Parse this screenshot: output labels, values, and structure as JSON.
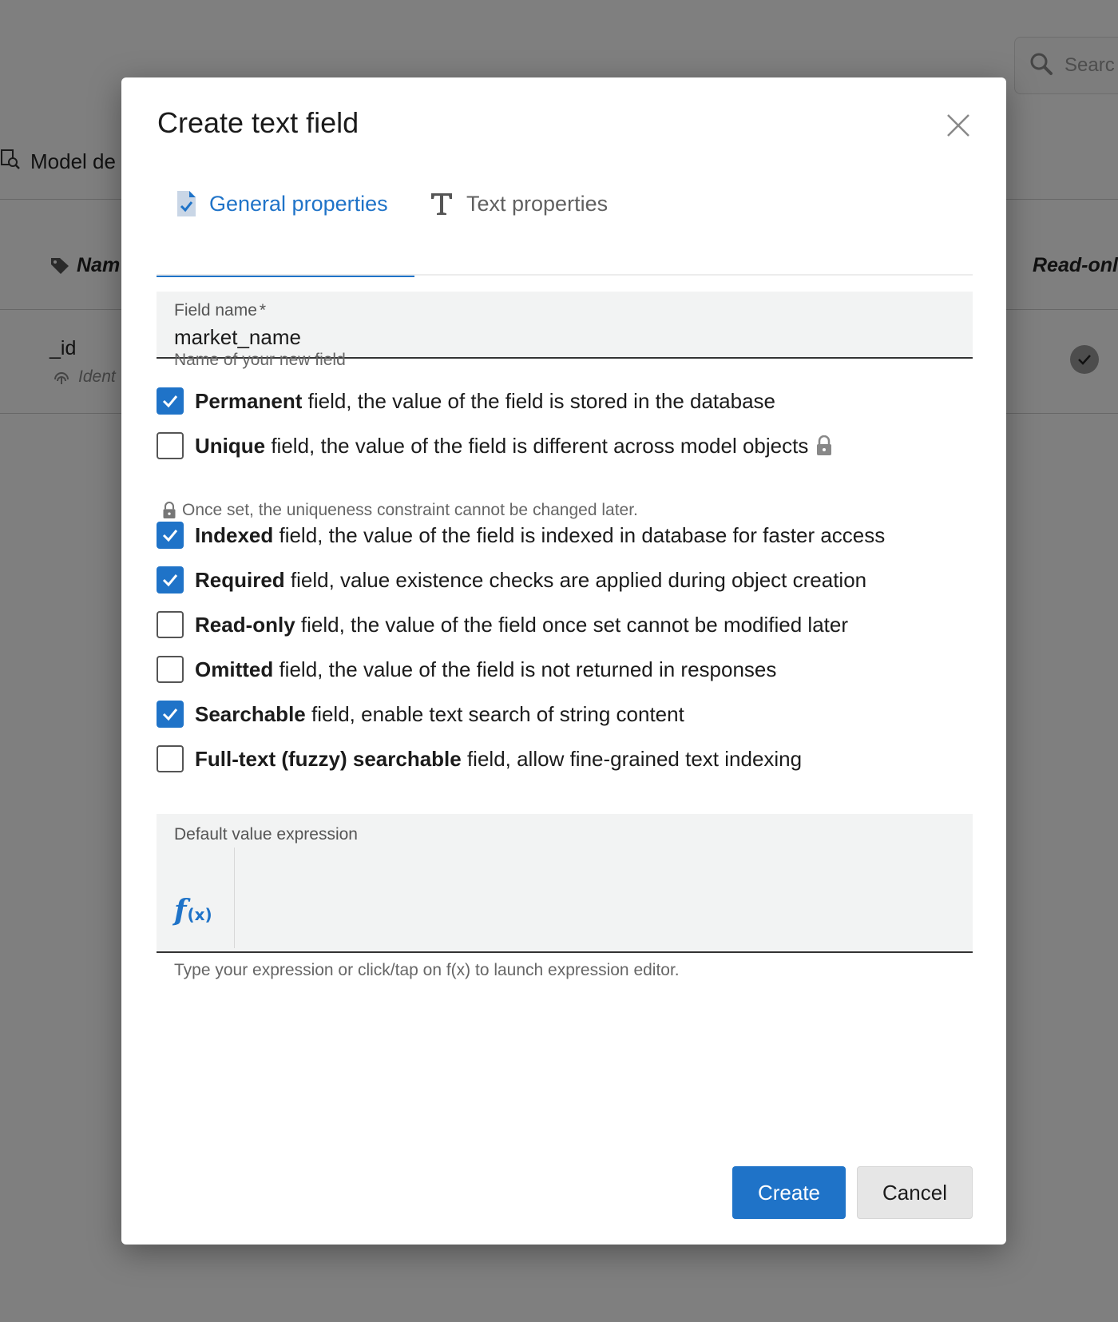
{
  "background": {
    "search_placeholder": "Searc",
    "model_label": "Model de",
    "column_name": "Nam",
    "column_readonly": "Read-onl",
    "row_id": "_id",
    "row_sub": "Ident"
  },
  "modal": {
    "title": "Create text field",
    "tabs": [
      {
        "label": "General properties",
        "active": true,
        "icon": "document-check-icon"
      },
      {
        "label": "Text properties",
        "active": false,
        "icon": "text-format-icon"
      }
    ],
    "field_name": {
      "label": "Field name",
      "required_mark": "*",
      "value": "market_name",
      "helper": "Name of your new field"
    },
    "checkboxes": [
      {
        "bold": "Permanent",
        "rest": " field, the value of the field is stored in the database",
        "checked": true
      },
      {
        "bold": "Unique",
        "rest": " field, the value of the field is different across model objects",
        "checked": false
      },
      {
        "bold": "Indexed",
        "rest": " field, the value of the field is indexed in database for faster access",
        "checked": true
      },
      {
        "bold": "Required",
        "rest": " field, value existence checks are applied during object creation",
        "checked": true
      },
      {
        "bold": "Read-only",
        "rest": " field, the value of the field once set cannot be modified later",
        "checked": false
      },
      {
        "bold": "Omitted",
        "rest": " field, the value of the field is not returned in responses",
        "checked": false
      },
      {
        "bold": "Searchable",
        "rest": " field, enable text search of string content",
        "checked": true
      },
      {
        "bold": "Full-text (fuzzy) searchable",
        "rest": " field, allow fine-grained text indexing",
        "checked": false
      }
    ],
    "unique_note": "Once set, the uniqueness constraint cannot be changed later.",
    "default_expression": {
      "label": "Default value expression",
      "value": "",
      "fx_f": "f",
      "fx_x": "(x)",
      "helper": "Type your expression or click/tap on f(x) to launch expression editor."
    },
    "buttons": {
      "create": "Create",
      "cancel": "Cancel"
    },
    "colors": {
      "accent": "#1f73c8"
    }
  }
}
